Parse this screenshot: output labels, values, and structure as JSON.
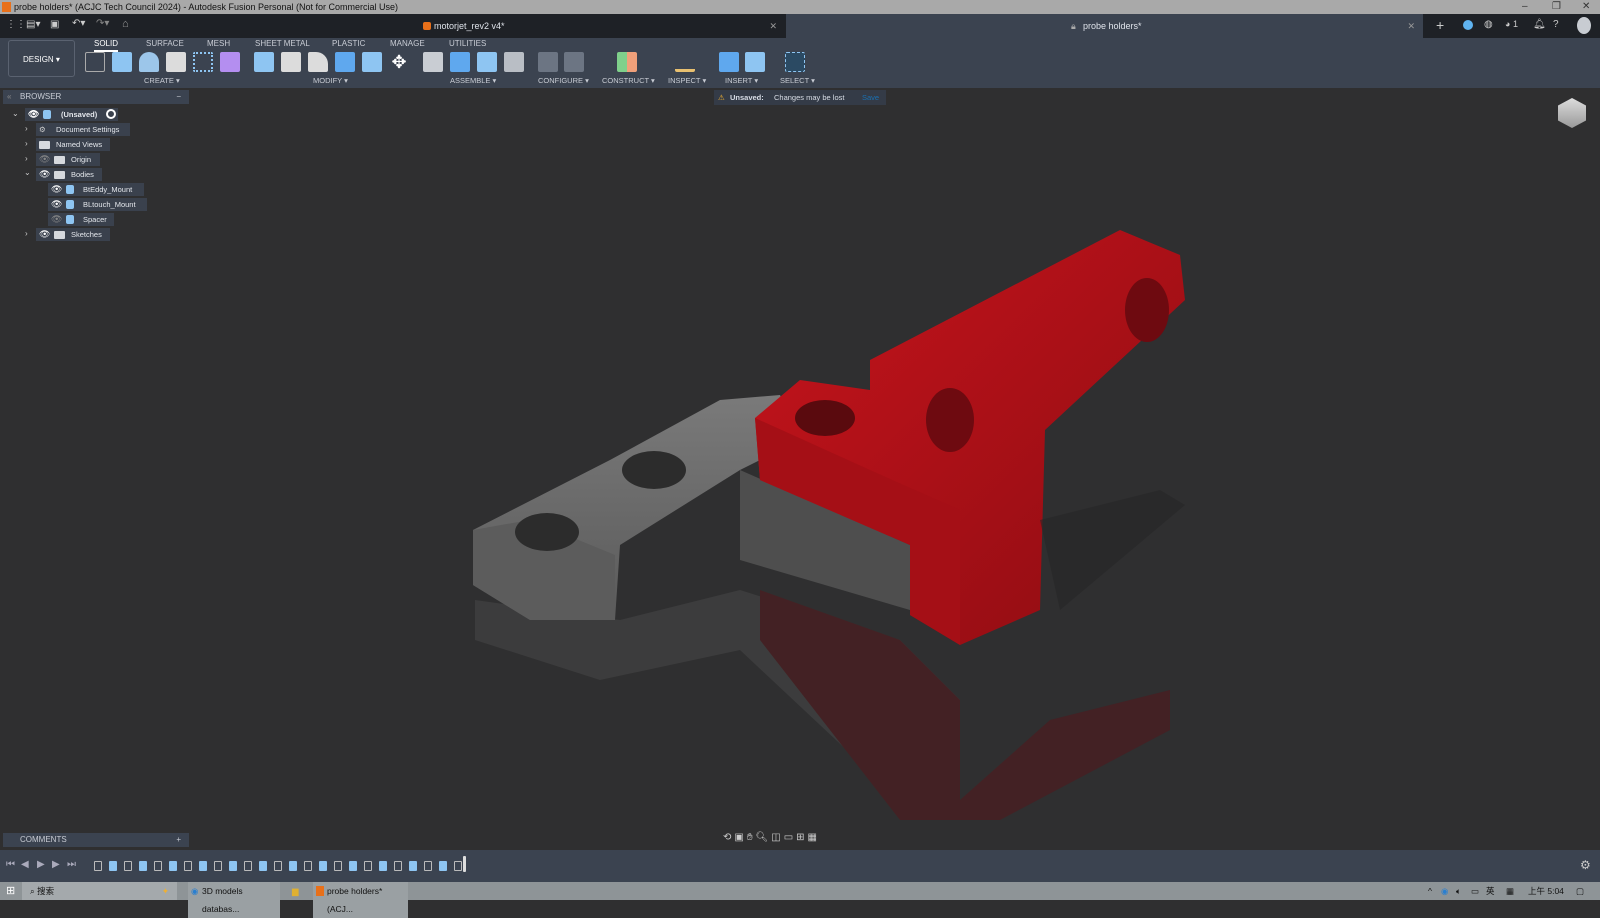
{
  "window": {
    "title": "probe holders* (ACJC Tech Council 2024) - Autodesk Fusion Personal (Not for Commercial Use)",
    "controls": [
      "–",
      "❐",
      "✕"
    ]
  },
  "tabs": [
    {
      "label": "motorjet_rev2 v4*"
    },
    {
      "label": "probe holders*"
    }
  ],
  "header_icons": {
    "job_count": "1"
  },
  "toolbar": {
    "workspace": "DESIGN ▾",
    "tabs": [
      "SOLID",
      "SURFACE",
      "MESH",
      "SHEET METAL",
      "PLASTIC",
      "MANAGE",
      "UTILITIES"
    ],
    "groups": [
      "CREATE ▾",
      "MODIFY ▾",
      "ASSEMBLE ▾",
      "CONFIGURE ▾",
      "CONSTRUCT ▾",
      "INSPECT ▾",
      "INSERT ▾",
      "SELECT ▾"
    ]
  },
  "browser": {
    "title": "BROWSER",
    "root": "(Unsaved)",
    "items": [
      "Document Settings",
      "Named Views",
      "Origin",
      "Bodies",
      "BtEddy_Mount",
      "BLtouch_Mount",
      "Spacer",
      "Sketches"
    ]
  },
  "banner": {
    "label": "Unsaved:",
    "message": "Changes may be lost",
    "action": "Save"
  },
  "comments": {
    "title": "COMMENTS",
    "add": "+"
  },
  "taskbar": {
    "search": "搜索",
    "apps": [
      "3D models databas...",
      "probe holders* (ACJ..."
    ],
    "ime": "英",
    "time": "上午 5:04"
  },
  "colors": {
    "accent": "#0696d7",
    "body_red": "#b0121a",
    "body_gray": "#707070"
  }
}
